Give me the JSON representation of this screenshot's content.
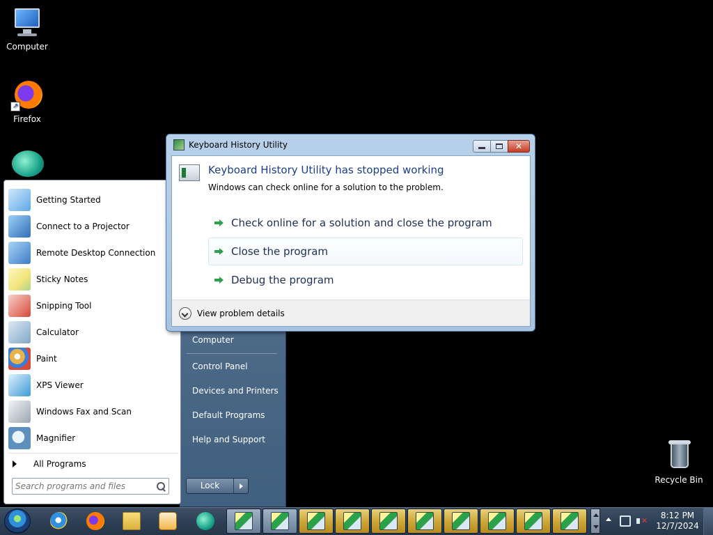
{
  "desktop": {
    "icons": [
      {
        "label": "Computer",
        "icon": "computer-icon"
      },
      {
        "label": "Firefox",
        "icon": "firefox-icon"
      },
      {
        "label": "",
        "icon": "teal-app-icon"
      },
      {
        "label": "Recycle Bin",
        "icon": "recycle-bin-icon"
      }
    ]
  },
  "start_menu": {
    "programs": [
      {
        "label": "Getting Started",
        "icon": "getting-started-icon",
        "color": "#5fa8e6"
      },
      {
        "label": "Connect to a Projector",
        "icon": "projector-icon",
        "color": "#2e6fb8"
      },
      {
        "label": "Remote Desktop Connection",
        "icon": "remote-desktop-icon",
        "color": "#3d7cc7"
      },
      {
        "label": "Sticky Notes",
        "icon": "sticky-notes-icon",
        "color": "#f1e47a"
      },
      {
        "label": "Snipping Tool",
        "icon": "snipping-tool-icon",
        "color": "#d64a3a"
      },
      {
        "label": "Calculator",
        "icon": "calculator-icon",
        "color": "#7fa7c8"
      },
      {
        "label": "Paint",
        "icon": "paint-icon",
        "color": "#e8b347"
      },
      {
        "label": "XPS Viewer",
        "icon": "xps-viewer-icon",
        "color": "#3c9ad8"
      },
      {
        "label": "Windows Fax and Scan",
        "icon": "fax-scan-icon",
        "color": "#9aa6b2"
      },
      {
        "label": "Magnifier",
        "icon": "magnifier-icon",
        "color": "#5d8fbf"
      }
    ],
    "all_programs": "All Programs",
    "search_placeholder": "Search programs and files",
    "right_links": [
      "Computer",
      "Control Panel",
      "Devices and Printers",
      "Default Programs",
      "Help and Support"
    ],
    "lock_label": "Lock"
  },
  "dialog": {
    "title": "Keyboard History Utility",
    "main_instruction": "Keyboard History Utility has stopped working",
    "sub_text": "Windows can check online for a solution to the problem.",
    "commands": [
      "Check online for a solution and close the program",
      "Close the program",
      "Debug the program"
    ],
    "details_label": "View problem details"
  },
  "taskbar": {
    "pinned": [
      {
        "name": "internet-explorer-icon"
      },
      {
        "name": "firefox-icon"
      },
      {
        "name": "explorer-folder-icon"
      },
      {
        "name": "media-player-icon"
      },
      {
        "name": "teal-app-icon"
      }
    ],
    "running_count_label": "Keyboard History Utility",
    "clock_time": "8:12 PM",
    "clock_date": "12/7/2024"
  },
  "colors": {
    "dialog_heading": "#1a3e8a",
    "command_arrow": "#2aa14a",
    "taskbar_active": "#cfa839"
  }
}
